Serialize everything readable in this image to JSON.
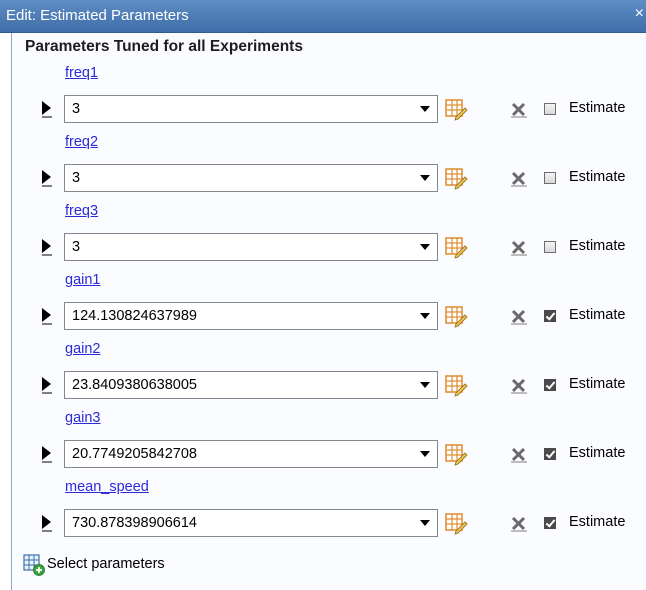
{
  "window": {
    "title": "Edit: Estimated Parameters",
    "close_glyph": "×"
  },
  "panel": {
    "title": "Parameters Tuned for all Experiments"
  },
  "params": [
    {
      "name": "freq1",
      "value": "3",
      "estimate_label": "Estimate",
      "estimate_checked": false
    },
    {
      "name": "freq2",
      "value": "3",
      "estimate_label": "Estimate",
      "estimate_checked": false
    },
    {
      "name": "freq3",
      "value": "3",
      "estimate_label": "Estimate",
      "estimate_checked": false
    },
    {
      "name": "gain1",
      "value": "124.130824637989",
      "estimate_label": "Estimate",
      "estimate_checked": true
    },
    {
      "name": "gain2",
      "value": "23.8409380638005",
      "estimate_label": "Estimate",
      "estimate_checked": true
    },
    {
      "name": "gain3",
      "value": "20.7749205842708",
      "estimate_label": "Estimate",
      "estimate_checked": true
    },
    {
      "name": "mean_speed",
      "value": "730.878398906614",
      "estimate_label": "Estimate",
      "estimate_checked": true
    }
  ],
  "footer": {
    "select_label": "Select parameters"
  },
  "colors": {
    "titlebar": "#4a7ab6",
    "link": "#2a2ad8",
    "panel_bg": "#fbfcff"
  }
}
